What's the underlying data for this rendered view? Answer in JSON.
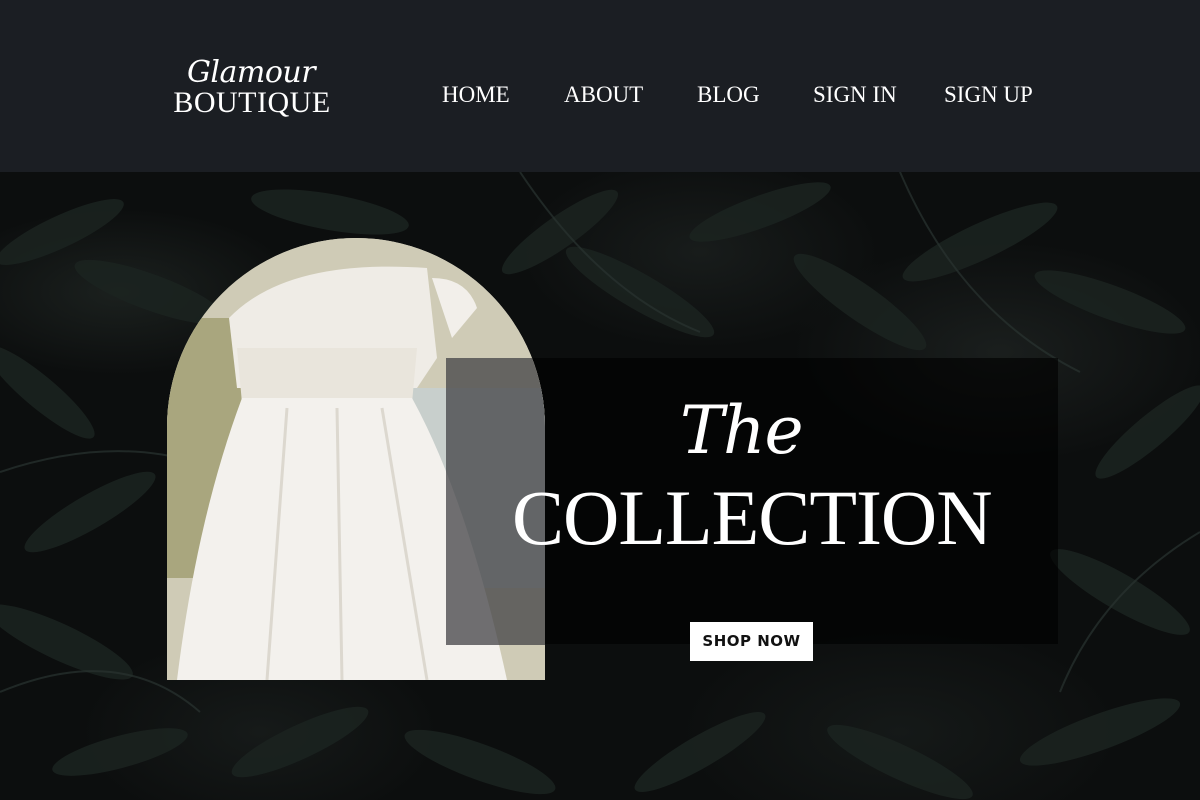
{
  "brand": {
    "script": "Glamour",
    "main": "BOUTIQUE"
  },
  "nav": {
    "home": "HOME",
    "about": "ABOUT",
    "blog": "BLOG",
    "sign_in": "SIGN IN",
    "sign_up": "SIGN UP"
  },
  "hero": {
    "title_script": "The",
    "title_main": "COLLECTION",
    "cta_label": "SHOP NOW"
  },
  "colors": {
    "header_bg": "#1b1e23",
    "hero_bg": "#0c0e0e",
    "text": "#ffffff",
    "button_bg": "#ffffff",
    "button_text": "#111111"
  }
}
